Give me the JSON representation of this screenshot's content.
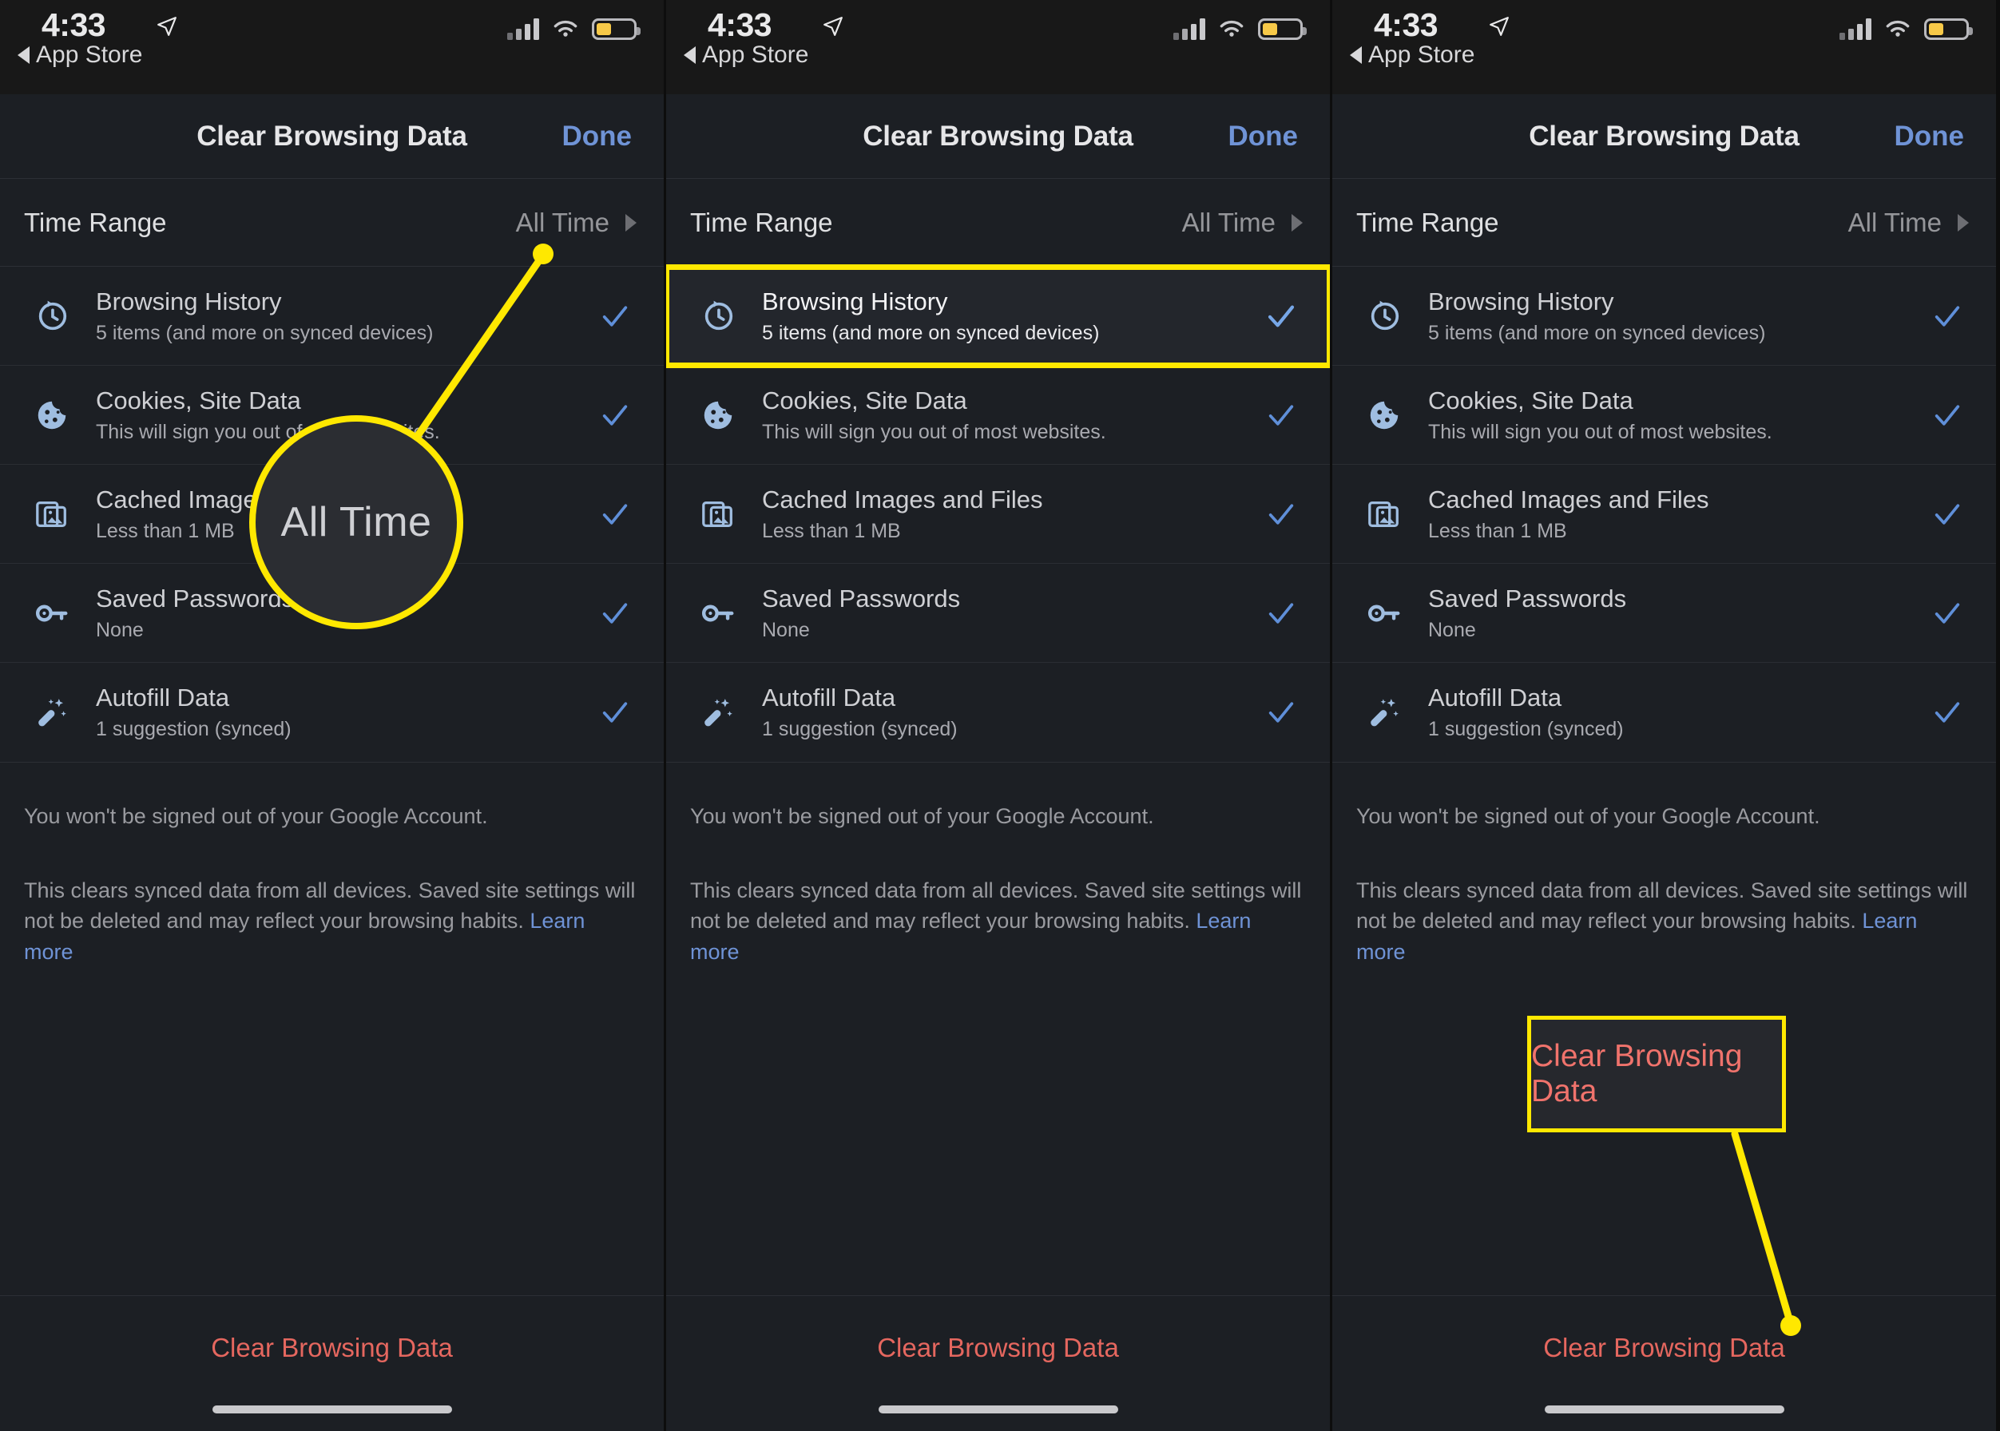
{
  "status_bar": {
    "time": "4:33",
    "back_label": "App Store",
    "location_icon": "location-arrow-icon",
    "signal_icon": "cellular-signal-icon",
    "wifi_icon": "wifi-icon",
    "battery_icon": "battery-low-power-icon",
    "battery_color": "#f7c948"
  },
  "nav": {
    "title": "Clear Browsing Data",
    "done_label": "Done",
    "done_color": "#6f93d6"
  },
  "time_range": {
    "label": "Time Range",
    "value": "All Time",
    "chevron_icon": "chevron-right-icon"
  },
  "list_items": [
    {
      "icon": "history-clock-icon",
      "title": "Browsing History",
      "subtitle": "5 items (and more on synced devices)",
      "checked": true
    },
    {
      "icon": "cookie-icon",
      "title": "Cookies, Site Data",
      "subtitle": "This will sign you out of most websites.",
      "checked": true
    },
    {
      "icon": "cached-images-icon",
      "title": "Cached Images and Files",
      "subtitle": "Less than 1 MB",
      "checked": true
    },
    {
      "icon": "key-icon",
      "title": "Saved Passwords",
      "subtitle": "None",
      "checked": true
    },
    {
      "icon": "magic-wand-icon",
      "title": "Autofill Data",
      "subtitle": "1 suggestion (synced)",
      "checked": true
    }
  ],
  "notes": {
    "line1": "You won't be signed out of your Google Account.",
    "line2": "This clears synced data from all devices. Saved site settings will not be deleted and may reflect your browsing habits. ",
    "learn_more": "Learn more"
  },
  "bottom": {
    "clear_label": "Clear Browsing Data",
    "clear_color": "#e5675f",
    "home_indicator": "home-indicator"
  },
  "annotations": {
    "highlight_color": "#ffe800",
    "panel1_magnifier_text": "All Time",
    "panel3_callout_text": "Clear Browsing Data"
  }
}
